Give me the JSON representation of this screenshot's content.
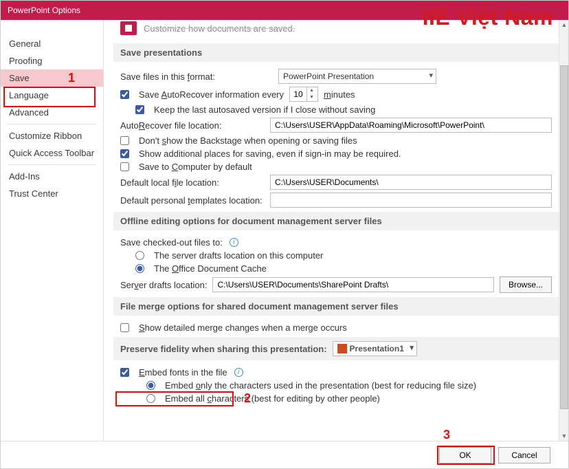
{
  "window": {
    "title": "PowerPoint Options"
  },
  "watermark": "IIE Việt Nam",
  "callouts": {
    "one": "1",
    "two": "2",
    "three": "3"
  },
  "sidebar": {
    "items": [
      "General",
      "Proofing",
      "Save",
      "Language",
      "Advanced",
      "Customize Ribbon",
      "Quick Access Toolbar",
      "Add-Ins",
      "Trust Center"
    ]
  },
  "stub": {
    "truncated_header_text": "Customize how documents are saved."
  },
  "sections": {
    "save_presentations": "Save presentations",
    "offline": "Offline editing options for document management server files",
    "merge": "File merge options for shared document management server files",
    "preserve": "Preserve fidelity when sharing this presentation:"
  },
  "save": {
    "format_label_pre": "Save files in this ",
    "format_label_u": "f",
    "format_label_post": "ormat:",
    "format_value": "PowerPoint Presentation",
    "autorec_pre": "Save ",
    "autorec_u": "A",
    "autorec_mid": "utoRecover information every",
    "autorec_minutes": "10",
    "autorec_min_pre": "",
    "autorec_min_u": "m",
    "autorec_min_post": "inutes",
    "keeplast": "Keep the last autosaved version if I close without saving",
    "autorec_loc_label_pre": "Auto",
    "autorec_loc_label_u": "R",
    "autorec_loc_label_post": "ecover file location:",
    "autorec_loc_value": "C:\\Users\\USER\\AppData\\Roaming\\Microsoft\\PowerPoint\\",
    "dontshow_pre": "Don't ",
    "dontshow_u": "s",
    "dontshow_post": "how the Backstage when opening or saving files",
    "additional": "Show additional places for saving, even if sign-in may be required.",
    "savecomp_pre": "Save to ",
    "savecomp_u": "C",
    "savecomp_post": "omputer by default",
    "localfile_pre": "Default local f",
    "localfile_u": "i",
    "localfile_post": "le location:",
    "localfile_value": "C:\\Users\\USER\\Documents\\",
    "templates_pre": "Default personal ",
    "templates_u": "t",
    "templates_post": "emplates location:",
    "templates_value": ""
  },
  "offline": {
    "checkedout_label": "Save checked-out files to:",
    "opt_server": "The server drafts location on this computer",
    "opt_cache_pre": "The ",
    "opt_cache_u": "O",
    "opt_cache_post": "ffice Document Cache",
    "drafts_pre": "Ser",
    "drafts_u": "v",
    "drafts_post": "er drafts location:",
    "drafts_value": "C:\\Users\\USER\\Documents\\SharePoint Drafts\\",
    "browse": "Browse..."
  },
  "merge": {
    "detail_pre": "",
    "detail_u": "S",
    "detail_post": "how detailed merge changes when a merge occurs"
  },
  "preserve": {
    "doc_value": "Presentation1",
    "embed_pre": "",
    "embed_u": "E",
    "embed_post": "mbed fonts in the file",
    "only_pre": "Embed ",
    "only_u": "o",
    "only_post": "nly the characters used in the presentation (best for reducing file size)",
    "all_pre": "Embed all ",
    "all_u": "c",
    "all_post": "haracters (best for editing by other people)"
  },
  "footer": {
    "ok": "OK",
    "cancel": "Cancel"
  }
}
